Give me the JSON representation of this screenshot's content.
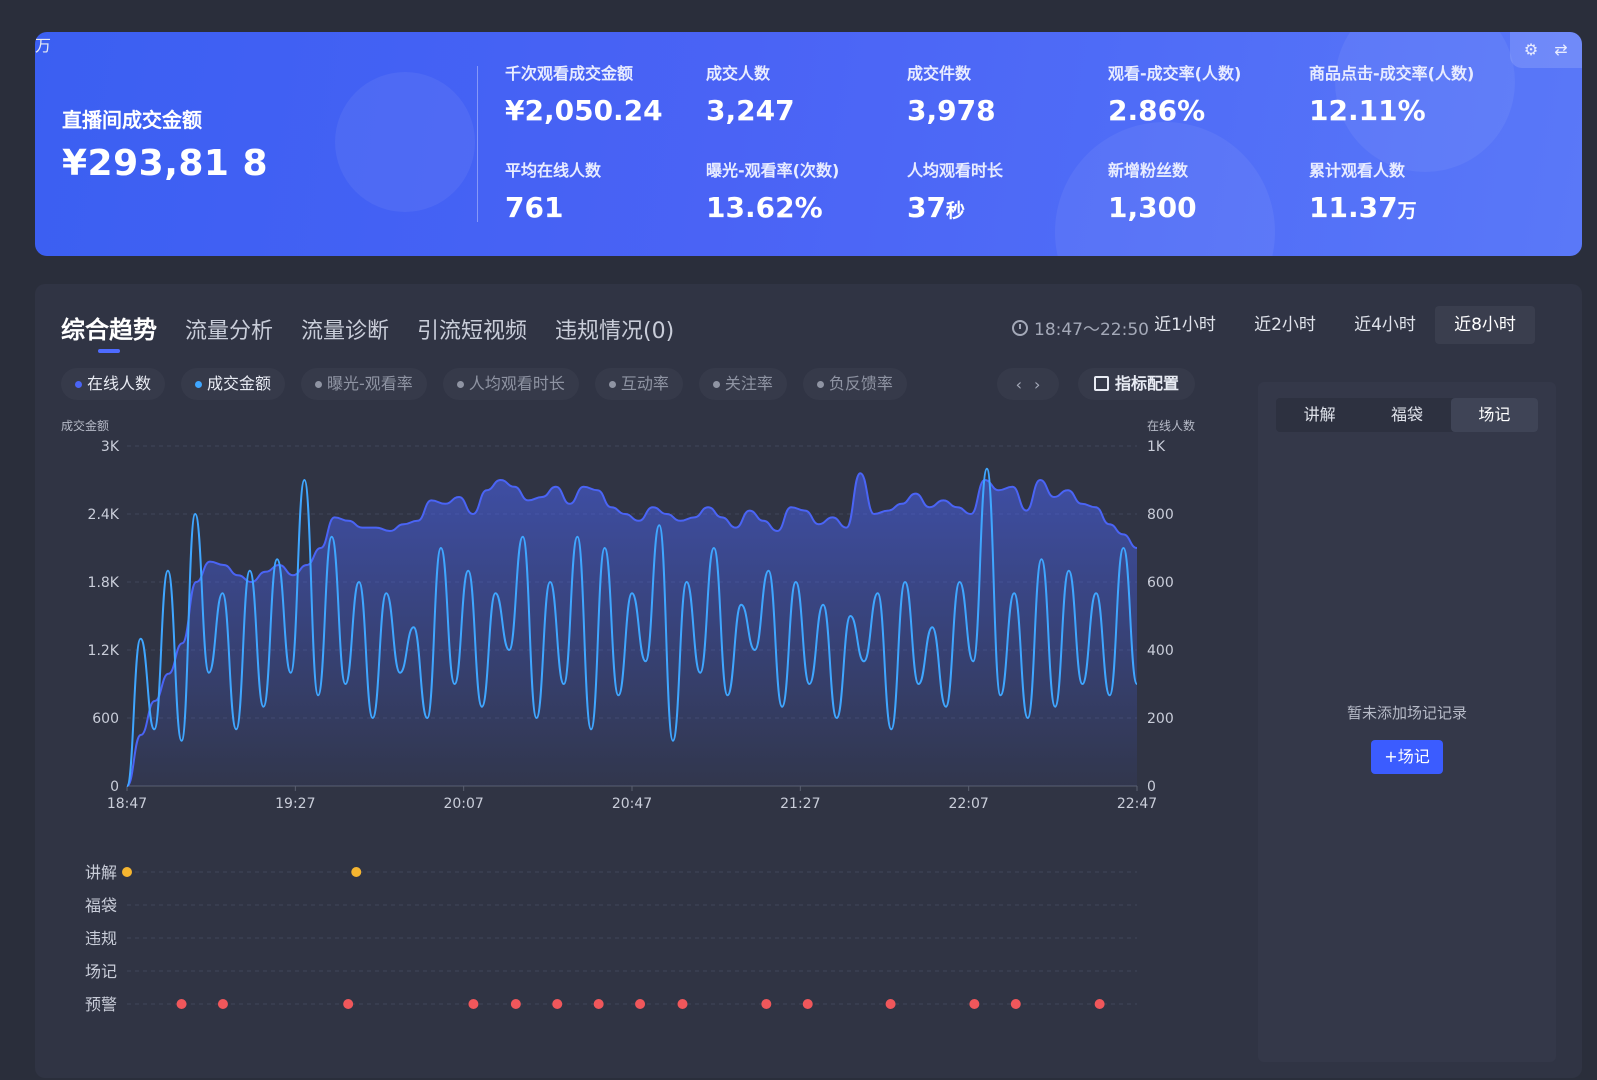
{
  "banner": {
    "total_label": "直播间成交金额",
    "total_value": "¥293,81 8",
    "total_unit": "万",
    "metrics": [
      {
        "label": "千次观看成交金额",
        "value": "¥2,050.24",
        "unit": ""
      },
      {
        "label": "成交人数",
        "value": "3,247",
        "unit": ""
      },
      {
        "label": "成交件数",
        "value": "3,978",
        "unit": ""
      },
      {
        "label": "观看-成交率(人数)",
        "value": "2.86%",
        "unit": ""
      },
      {
        "label": "商品点击-成交率(人数)",
        "value": "12.11%",
        "unit": ""
      },
      {
        "label": "平均在线人数",
        "value": "761",
        "unit": ""
      },
      {
        "label": "曝光-观看率(次数)",
        "value": "13.62%",
        "unit": ""
      },
      {
        "label": "人均观看时长",
        "value": "37",
        "unit": "秒"
      },
      {
        "label": "新增粉丝数",
        "value": "1,300",
        "unit": ""
      },
      {
        "label": "累计观看人数",
        "value": "11.37",
        "unit": "万"
      }
    ],
    "tools": [
      "gear-icon",
      "swap-icon"
    ]
  },
  "tabs": [
    "综合趋势",
    "流量分析",
    "流量诊断",
    "引流短视频",
    "违规情况(0)"
  ],
  "time_range": "18:47～22:50",
  "ranges": [
    "近1小时",
    "近2小时",
    "近4小时",
    "近8小时"
  ],
  "active_range": 3,
  "pills": [
    {
      "label": "在线人数",
      "on": true,
      "color": "#4a64f5"
    },
    {
      "label": "成交金额",
      "on": true,
      "color": "#3fa6ff"
    },
    {
      "label": "曝光-观看率",
      "on": false,
      "color": "#8f94a3"
    },
    {
      "label": "人均观看时长",
      "on": false,
      "color": "#8f94a3"
    },
    {
      "label": "互动率",
      "on": false,
      "color": "#8f94a3"
    },
    {
      "label": "关注率",
      "on": false,
      "color": "#8f94a3"
    },
    {
      "label": "负反馈率",
      "on": false,
      "color": "#8f94a3"
    }
  ],
  "config_label": "指标配置",
  "side": {
    "tabs": [
      "讲解",
      "福袋",
      "场记"
    ],
    "active": 2,
    "empty_text": "暂未添加场记记录",
    "add_label": "+场记"
  },
  "chart_data": {
    "type": "line",
    "ylabel_left": "成交金额",
    "ylabel_right": "在线人数",
    "left_ticks": [
      "0",
      "600",
      "1.2K",
      "1.8K",
      "2.4K",
      "3K"
    ],
    "right_ticks": [
      "0",
      "200",
      "400",
      "600",
      "800",
      "1K"
    ],
    "ylim_left": [
      0,
      3000
    ],
    "ylim_right": [
      0,
      1000
    ],
    "x_ticks": [
      "18:47",
      "19:27",
      "20:07",
      "20:47",
      "21:27",
      "22:07",
      "22:47"
    ],
    "series": [
      {
        "name": "在线人数",
        "axis": "right",
        "color": "#4a64f5",
        "values": [
          0,
          150,
          250,
          330,
          420,
          600,
          660,
          650,
          620,
          600,
          630,
          650,
          620,
          650,
          700,
          790,
          780,
          760,
          760,
          750,
          770,
          780,
          840,
          830,
          850,
          800,
          870,
          900,
          880,
          840,
          850,
          880,
          830,
          880,
          870,
          820,
          800,
          780,
          820,
          800,
          780,
          790,
          820,
          790,
          760,
          810,
          780,
          750,
          820,
          810,
          770,
          790,
          760,
          920,
          800,
          810,
          830,
          860,
          820,
          840,
          820,
          800,
          900,
          870,
          880,
          810,
          900,
          850,
          870,
          830,
          820,
          770,
          740,
          700
        ]
      },
      {
        "name": "成交金额",
        "axis": "left",
        "color": "#3fa6ff",
        "values": [
          0,
          1300,
          500,
          1900,
          400,
          2400,
          1000,
          1700,
          500,
          1900,
          700,
          2000,
          1000,
          2700,
          800,
          2200,
          900,
          1800,
          600,
          1700,
          1000,
          1400,
          600,
          2100,
          900,
          1900,
          700,
          1700,
          1200,
          2200,
          600,
          1800,
          900,
          2200,
          500,
          2100,
          800,
          1700,
          1100,
          2300,
          400,
          1800,
          1000,
          2100,
          800,
          1600,
          1200,
          1900,
          700,
          1800,
          900,
          1600,
          600,
          1500,
          1100,
          1700,
          500,
          1800,
          900,
          1400,
          700,
          1800,
          1100,
          2800,
          800,
          1700,
          600,
          2000,
          700,
          1900,
          900,
          1700,
          800,
          2100,
          900
        ]
      }
    ]
  },
  "timeline": {
    "rows": [
      "讲解",
      "福袋",
      "违规",
      "场记",
      "预警"
    ],
    "row_colors": {
      "讲解": "#f5b530",
      "预警": "#f0575b"
    },
    "events": {
      "讲解": [
        0,
        0.227
      ],
      "预警": [
        0.054,
        0.095,
        0.219,
        0.343,
        0.385,
        0.426,
        0.467,
        0.508,
        0.55,
        0.633,
        0.674,
        0.756,
        0.839,
        0.88,
        0.963
      ]
    }
  }
}
